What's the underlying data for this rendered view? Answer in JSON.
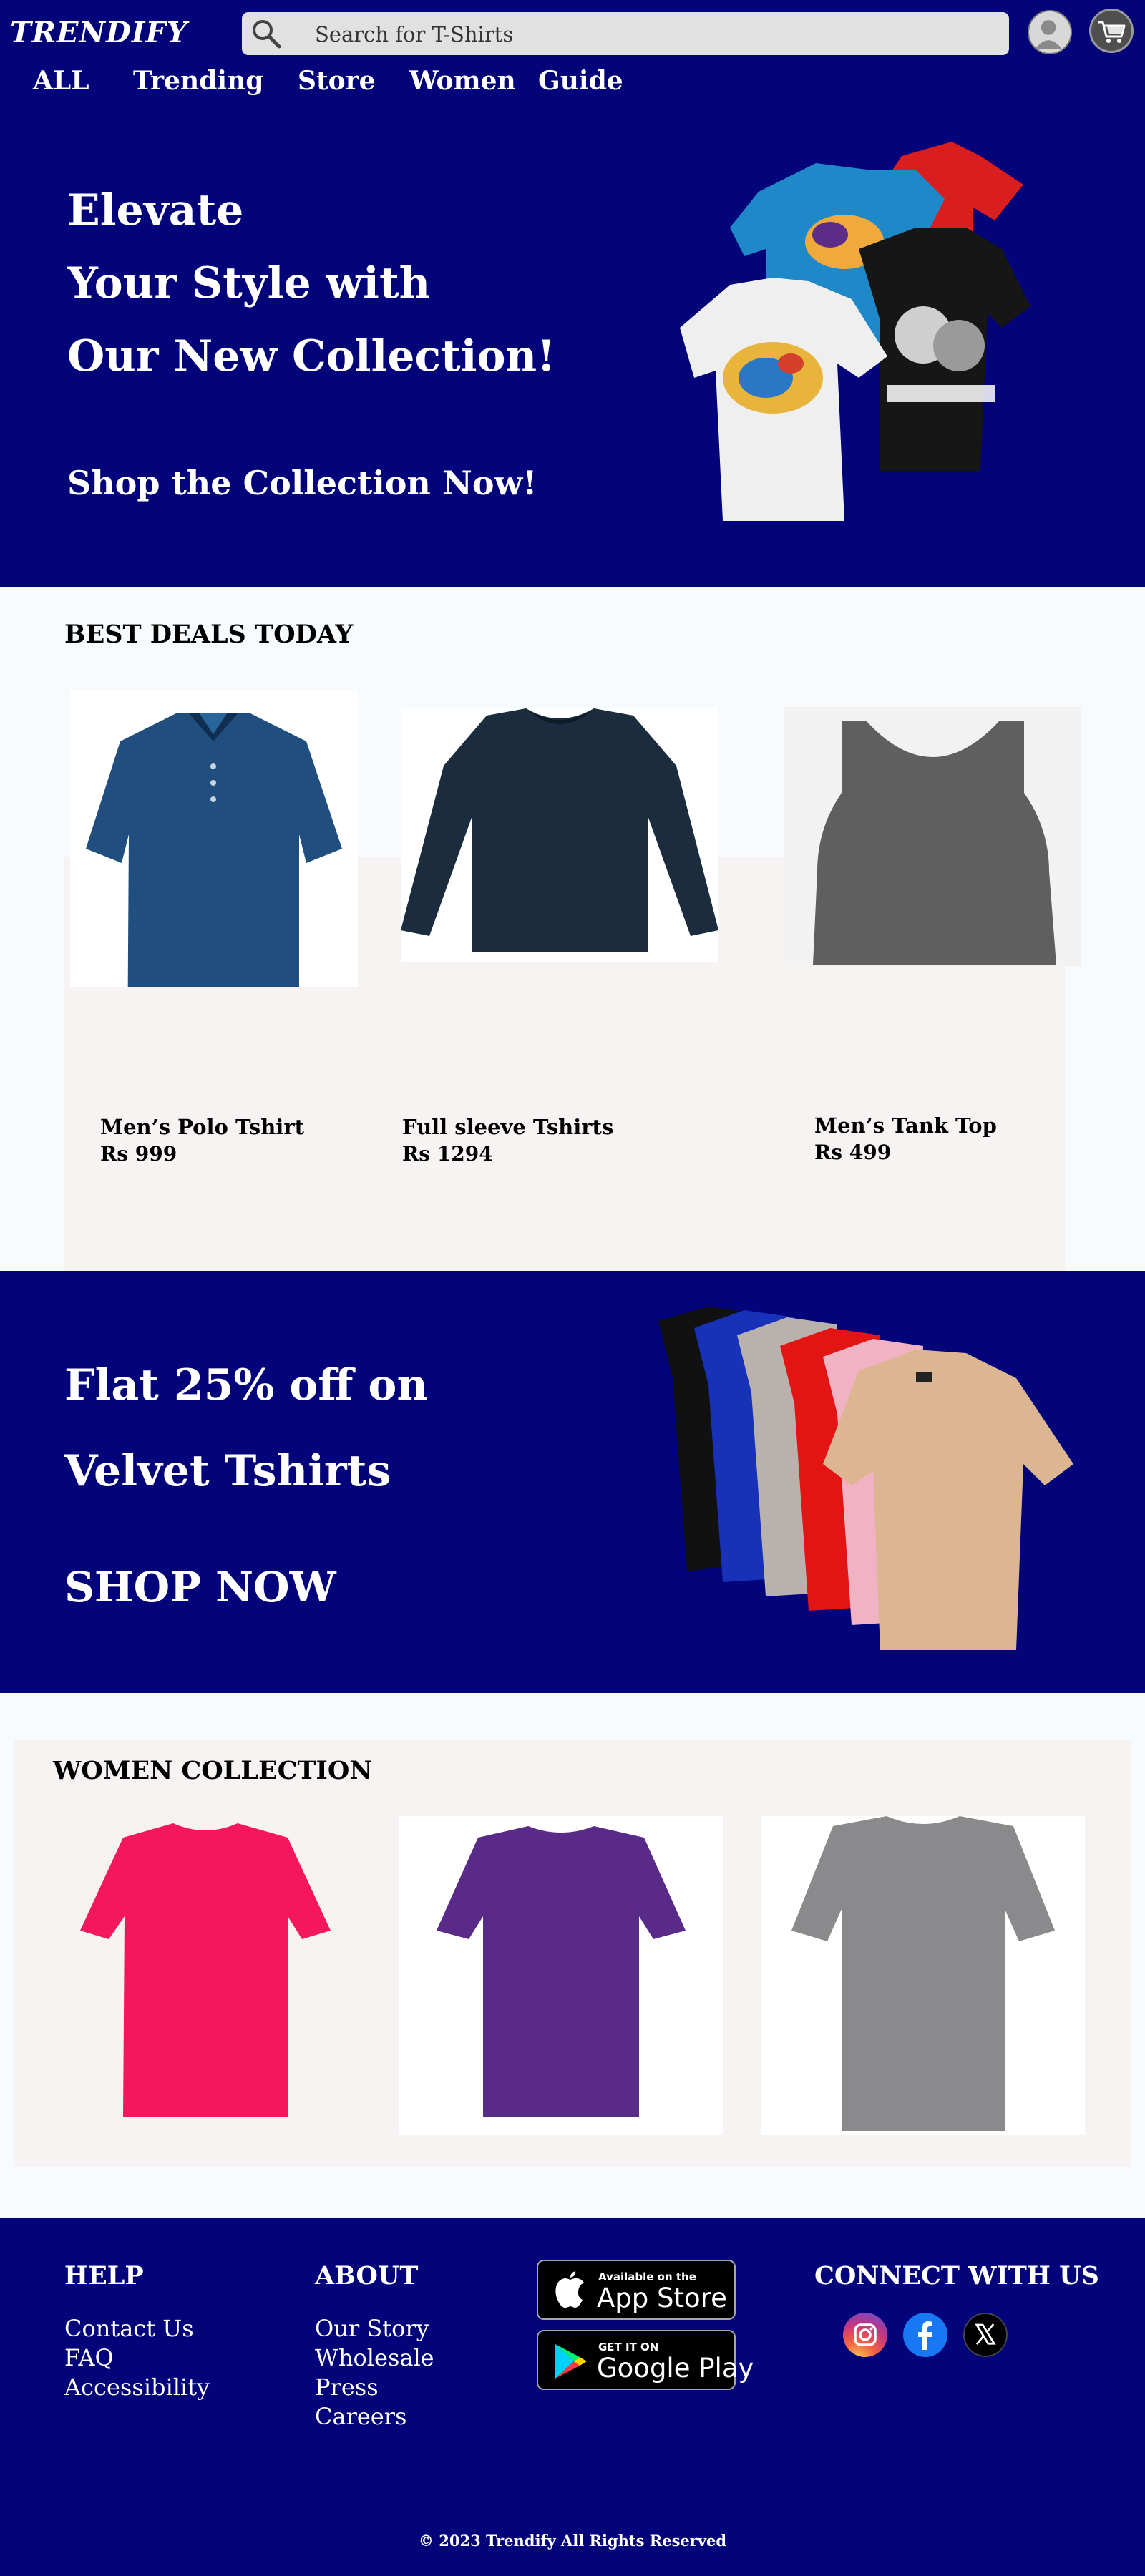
{
  "brand": {
    "logo": "TRENDIFY"
  },
  "search": {
    "placeholder": "Search for T-Shirts"
  },
  "nav": {
    "items": [
      "ALL",
      "Trending",
      "Store",
      "Women",
      "Guide"
    ]
  },
  "hero": {
    "title_lines": [
      "Elevate",
      "Your Style with",
      "Our New Collection!"
    ],
    "cta": "Shop the Collection Now!"
  },
  "deals": {
    "title": "BEST DEALS TODAY",
    "products": [
      {
        "name": "Men’s Polo Tshirt",
        "price": "Rs 999"
      },
      {
        "name": "Full sleeve Tshirts",
        "price": "Rs 1294"
      },
      {
        "name": "Men’s Tank Top",
        "price": "Rs 499"
      }
    ]
  },
  "promo": {
    "title_lines": [
      "Flat 25% off on",
      "Velvet Tshirts"
    ],
    "cta": "SHOP NOW"
  },
  "women": {
    "title": "WOMEN COLLECTION"
  },
  "footer": {
    "help": {
      "title": "HELP",
      "links": [
        "Contact Us",
        "FAQ",
        "Accessibility"
      ]
    },
    "about": {
      "title": "ABOUT",
      "links": [
        "Our Story",
        "Wholesale",
        "Press",
        "Careers"
      ]
    },
    "app_store": {
      "small": "Available on the",
      "big": "App Store"
    },
    "google_play": {
      "small": "GET IT ON",
      "big": "Google Play"
    },
    "connect": {
      "title": "CONNECT WITH US"
    },
    "copyright": "© 2023 Trendify All Rights Reserved"
  },
  "colors": {
    "primary": "#03037a",
    "light_bg": "#f7fbfe",
    "panel_bg": "#f8f3f3",
    "search_bg": "#e2e1e2"
  },
  "icons": [
    "search-icon",
    "user-icon",
    "cart-icon",
    "apple-icon",
    "google-play-icon",
    "instagram-icon",
    "facebook-icon",
    "x-icon"
  ]
}
